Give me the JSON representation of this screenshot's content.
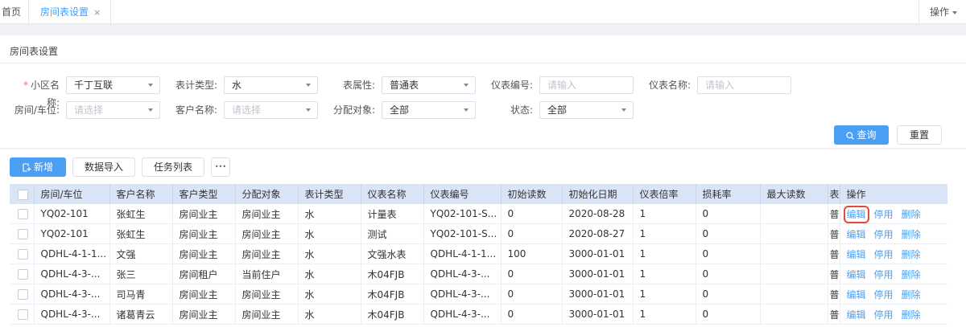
{
  "tabs": {
    "home": "首页",
    "active": "房间表设置",
    "close": "×",
    "ops_menu": "操作"
  },
  "card": {
    "title": "房间表设置"
  },
  "form": {
    "community_label": "小区名称:",
    "community_value": "千丁互联",
    "meter_type_label": "表计类型:",
    "meter_type_value": "水",
    "attr_label": "表属性:",
    "attr_value": "普通表",
    "meter_no_label": "仪表编号:",
    "meter_no_placeholder": "请输入",
    "meter_name_label": "仪表名称:",
    "meter_name_placeholder": "请输入",
    "room_label": "房间/车位:",
    "room_placeholder": "请选择",
    "customer_label": "客户名称:",
    "customer_placeholder": "请选择",
    "target_label": "分配对象:",
    "target_value": "全部",
    "status_label": "状态:",
    "status_value": "全部"
  },
  "actions": {
    "query": "查询",
    "reset": "重置"
  },
  "toolbar": {
    "add": "新增",
    "import": "数据导入",
    "tasks": "任务列表",
    "more": "•••"
  },
  "table": {
    "headers": [
      "房间/车位",
      "客户名称",
      "客户类型",
      "分配对象",
      "表计类型",
      "仪表名称",
      "仪表编号",
      "初始读数",
      "初始化日期",
      "仪表倍率",
      "损耗率",
      "最大读数",
      "表",
      "操作"
    ],
    "rows": [
      [
        "YQ02-101",
        "张虹生",
        "房间业主",
        "房间业主",
        "水",
        "计量表",
        "YQ02-101-S...",
        "0",
        "2020-08-28",
        "1",
        "0",
        "",
        "普"
      ],
      [
        "YQ02-101",
        "张虹生",
        "房间业主",
        "房间业主",
        "水",
        "测试",
        "YQ02-101-S...",
        "0",
        "2020-08-27",
        "1",
        "0",
        "",
        "普"
      ],
      [
        "QDHL-4-1-1...",
        "文强",
        "房间业主",
        "房间业主",
        "水",
        "文强水表",
        "QDHL-4-1-1...",
        "100",
        "3000-01-01",
        "1",
        "0",
        "",
        "普"
      ],
      [
        "QDHL-4-3-...",
        "张三",
        "房间租户",
        "当前住户",
        "水",
        "木04FJB",
        "QDHL-4-3-...",
        "0",
        "3000-01-01",
        "1",
        "0",
        "",
        "普"
      ],
      [
        "QDHL-4-3-...",
        "司马青",
        "房间业主",
        "房间业主",
        "水",
        "木04FJB",
        "QDHL-4-3-...",
        "0",
        "3000-01-01",
        "1",
        "0",
        "",
        "普"
      ],
      [
        "QDHL-4-3-...",
        "诸葛青云",
        "房间业主",
        "房间业主",
        "水",
        "木04FJB",
        "QDHL-4-3-...",
        "0",
        "3000-01-01",
        "1",
        "0",
        "",
        "普"
      ]
    ],
    "row_actions": {
      "edit": "编辑",
      "disable": "停用",
      "delete": "删除"
    }
  },
  "colors": {
    "primary": "#4a9ff5",
    "header_bg": "#d9e5f7",
    "highlight": "#e34a3a"
  }
}
